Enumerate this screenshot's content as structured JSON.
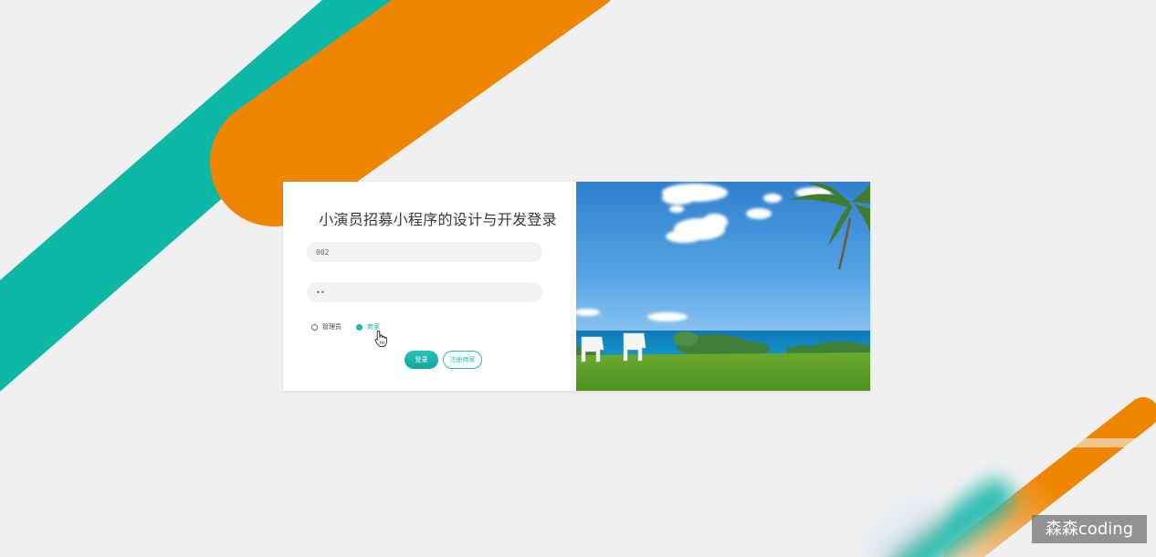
{
  "login": {
    "title": "小演员招募小程序的设计与开发登录",
    "username_value": "002",
    "password_value": "••",
    "roles": [
      {
        "label": "管理员",
        "checked": false
      },
      {
        "label": "商家",
        "checked": true
      }
    ],
    "login_button": "登录",
    "register_button": "注册商家"
  },
  "watermark": {
    "text": "森森coding"
  },
  "colors": {
    "teal": "#0db8a6",
    "orange": "#f08500",
    "background": "#f0f0f0"
  }
}
